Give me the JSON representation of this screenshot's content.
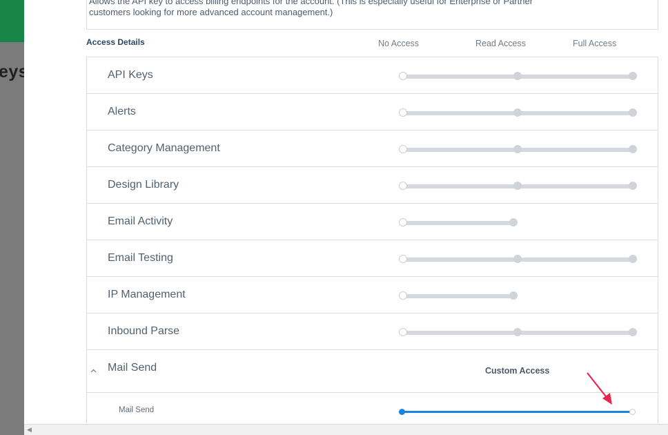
{
  "background_page": {
    "title_fragment": "eys"
  },
  "description": {
    "line1": "Allows the API key to access billing endpoints for the account. (This is especially useful for Enterprise or Partner",
    "line2": "customers looking for more advanced account management.)"
  },
  "access": {
    "title": "Access Details",
    "columns": [
      "No Access",
      "Read Access",
      "Full Access"
    ],
    "rows": [
      {
        "label": "API Keys",
        "levels": 3
      },
      {
        "label": "Alerts",
        "levels": 3
      },
      {
        "label": "Category Management",
        "levels": 3
      },
      {
        "label": "Design Library",
        "levels": 3
      },
      {
        "label": "Email Activity",
        "levels": 2
      },
      {
        "label": "Email Testing",
        "levels": 3
      },
      {
        "label": "IP Management",
        "levels": 2
      },
      {
        "label": "Inbound Parse",
        "levels": 3
      }
    ],
    "expanded": {
      "label": "Mail Send",
      "status": "Custom Access",
      "chevron_icon": "chevron-up-icon",
      "sub": {
        "label": "Mail Send",
        "value": "No Access"
      }
    }
  },
  "colors": {
    "accent": "#1a82e2",
    "annotation_arrow": "#e8254c",
    "brand_green": "#188546"
  }
}
